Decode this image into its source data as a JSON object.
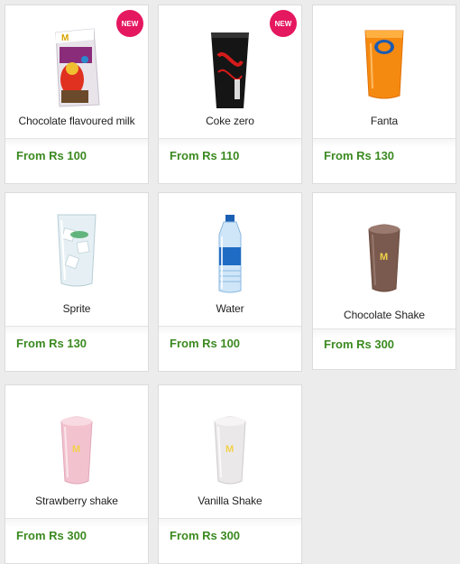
{
  "products": [
    {
      "name": "Chocolate flavoured milk",
      "price": "From Rs 100",
      "badge": "NEW"
    },
    {
      "name": "Coke zero",
      "price": "From Rs 110",
      "badge": "NEW"
    },
    {
      "name": "Fanta",
      "price": "From Rs 130"
    },
    {
      "name": "Sprite",
      "price": "From Rs 130"
    },
    {
      "name": "Water",
      "price": "From Rs 100"
    },
    {
      "name": "Chocolate Shake",
      "price": "From Rs 300"
    },
    {
      "name": "Strawberry shake",
      "price": "From Rs 300"
    },
    {
      "name": "Vanilla Shake",
      "price": "From Rs 300"
    }
  ],
  "logo_text": "M",
  "colors": {
    "price": "#3b8a20",
    "badge": "#e5175f"
  }
}
